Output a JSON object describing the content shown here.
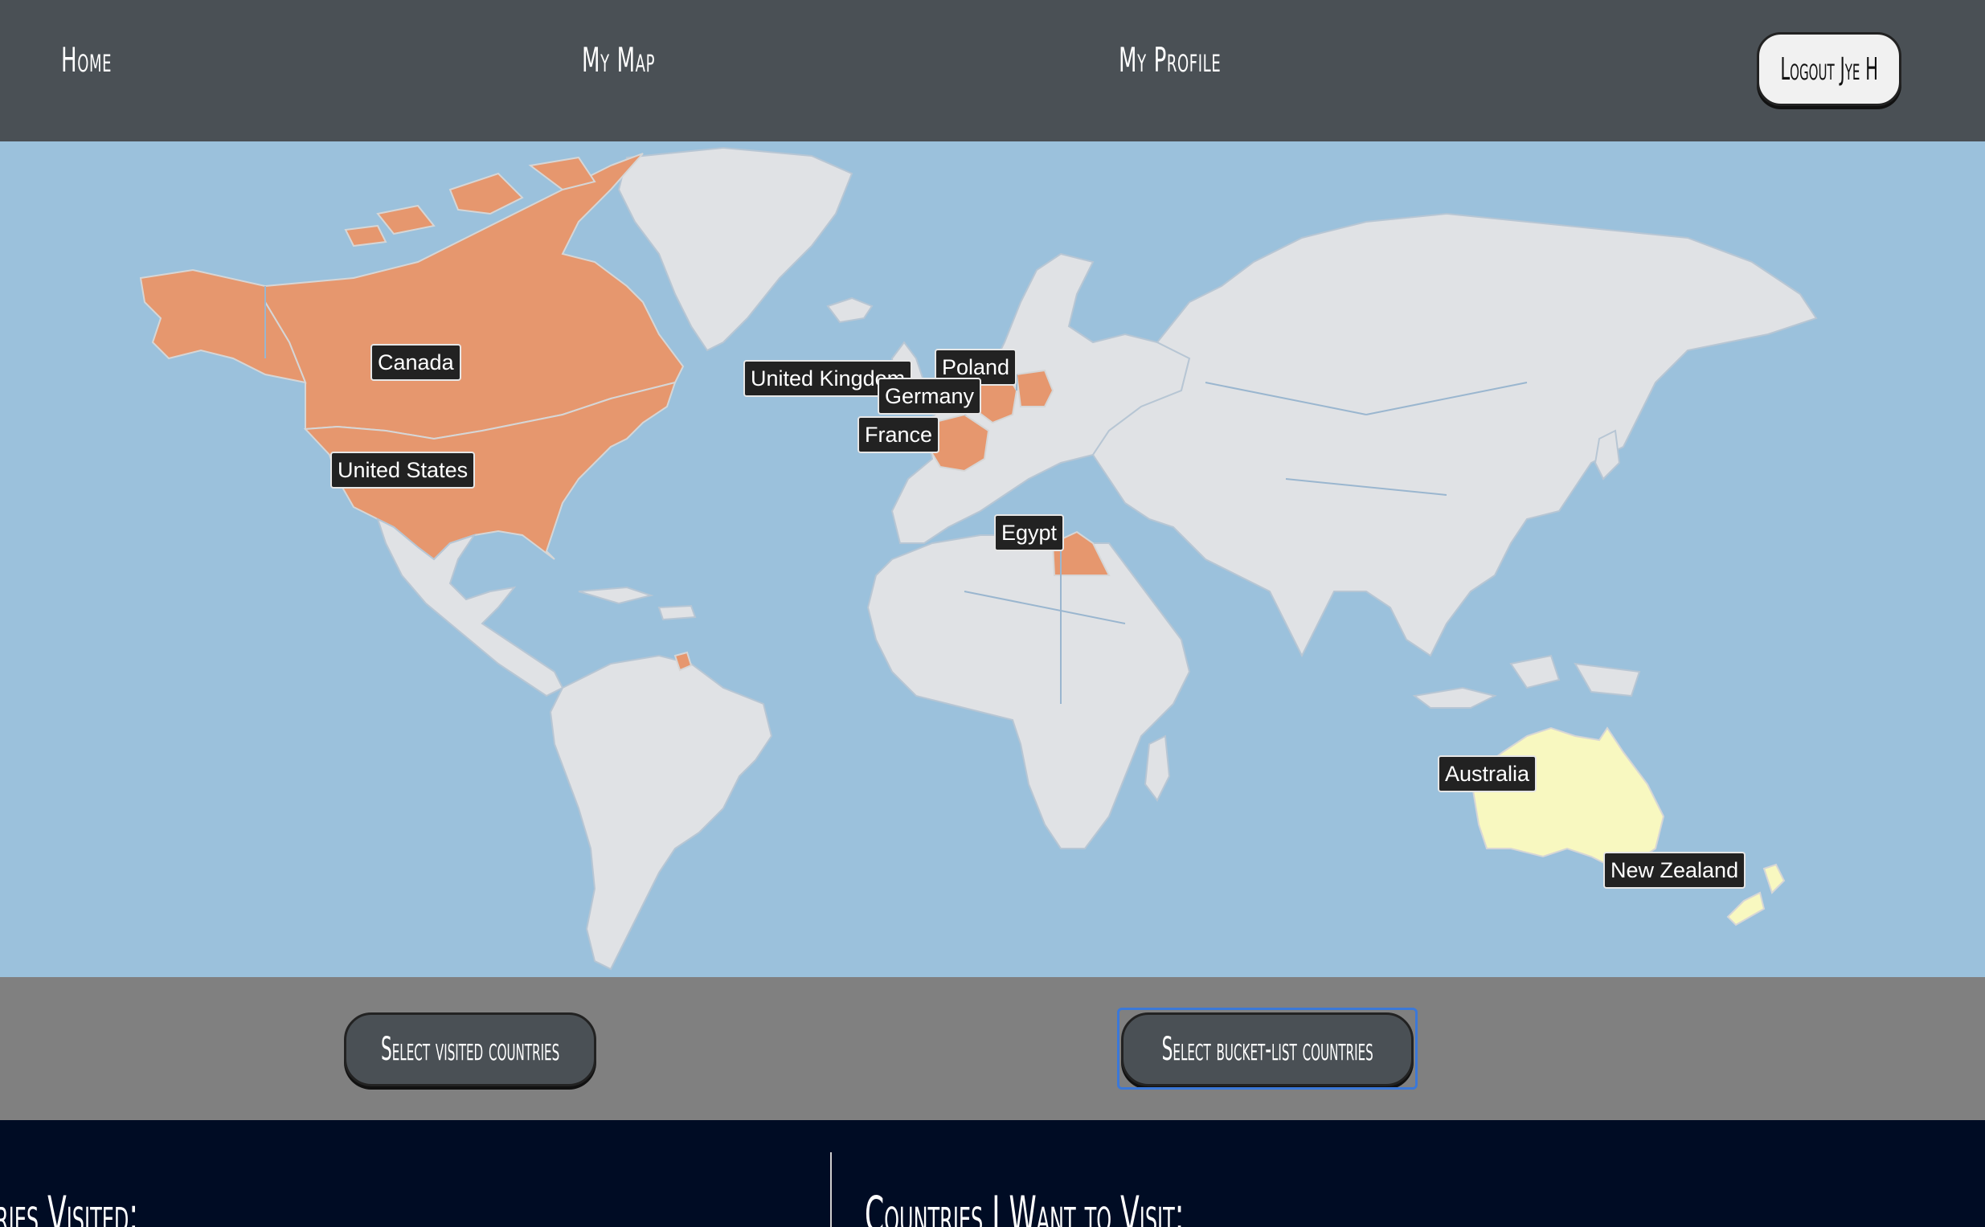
{
  "nav": {
    "home": "Home",
    "my_map": "My Map",
    "my_profile": "My Profile",
    "logout": "Logout Jye H"
  },
  "map": {
    "visited_color": "#e6976e",
    "bucket_color": "#f8f8c0",
    "land_color": "#e0e2e5",
    "ocean_color": "#9bc1dc",
    "labels": {
      "canada": "Canada",
      "united_states": "United States",
      "united_kingdom": "United Kingdom",
      "poland": "Poland",
      "germany": "Germany",
      "france": "France",
      "egypt": "Egypt",
      "australia": "Australia",
      "new_zealand": "New Zealand"
    }
  },
  "selectors": {
    "visited": "Select visited countries",
    "bucket": "Select bucket-list countries"
  },
  "lists": {
    "visited_heading": "ries Visited:",
    "want_heading": "Countries I Want to Visit:"
  }
}
